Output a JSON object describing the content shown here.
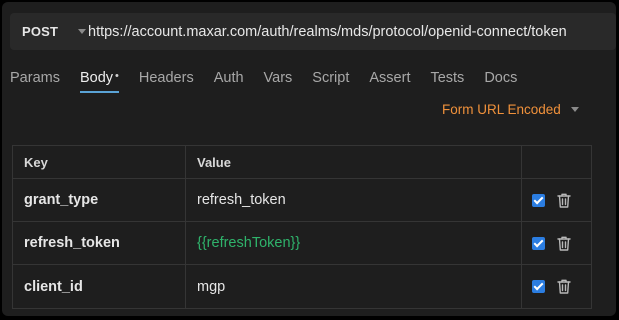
{
  "request": {
    "method": "POST",
    "url": "https://account.maxar.com/auth/realms/mds/protocol/openid-connect/token"
  },
  "tabs": [
    {
      "label": "Params"
    },
    {
      "label": "Body",
      "active": true,
      "modified": "•"
    },
    {
      "label": "Headers"
    },
    {
      "label": "Auth"
    },
    {
      "label": "Vars"
    },
    {
      "label": "Script"
    },
    {
      "label": "Assert"
    },
    {
      "label": "Tests"
    },
    {
      "label": "Docs"
    }
  ],
  "body_mode": "Form URL Encoded",
  "table": {
    "headers": {
      "key": "Key",
      "value": "Value"
    },
    "rows": [
      {
        "key": "grant_type",
        "value": "refresh_token",
        "enabled": true
      },
      {
        "key": "refresh_token",
        "value": "{{refreshToken}}",
        "enabled": true,
        "is_variable": true
      },
      {
        "key": "client_id",
        "value": "mgp",
        "enabled": true
      }
    ]
  },
  "colors": {
    "accent": "#5aa3d6",
    "body_mode": "#f0913b",
    "variable": "#2fb36b",
    "checkbox": "#2b7de1"
  },
  "icons": {
    "method_dropdown": "chevron-down-icon",
    "body_mode_dropdown": "chevron-down-icon",
    "row_delete": "trash-icon",
    "row_toggle": "checkbox-checked-icon"
  }
}
